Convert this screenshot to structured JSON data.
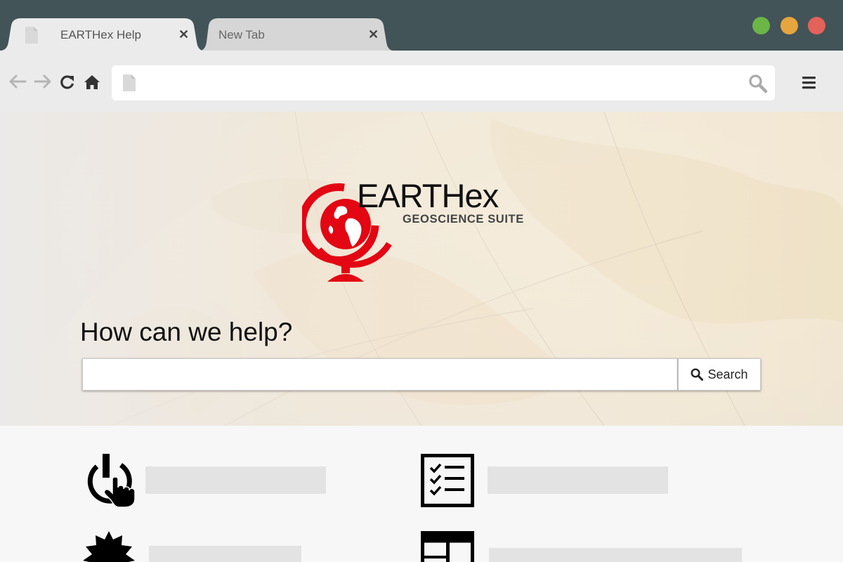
{
  "browser": {
    "tabs": [
      {
        "title": "EARTHex Help",
        "active": true
      },
      {
        "title": "New Tab",
        "active": false
      }
    ],
    "window_controls": [
      "maximize-green",
      "minimize-yellow",
      "close-red"
    ],
    "address_bar": {
      "value": "",
      "placeholder": ""
    },
    "nav_icons": [
      "back-arrow-icon",
      "forward-arrow-icon",
      "reload-icon",
      "home-icon"
    ]
  },
  "hero": {
    "logo": {
      "wordmark": "EARTHex",
      "tagline": "GEOSCIENCE SUITE"
    },
    "heading": "How can we help?",
    "search": {
      "value": "",
      "placeholder": "",
      "button_label": "Search"
    }
  },
  "categories": [
    {
      "icon": "power-touch-icon"
    },
    {
      "icon": "checklist-icon"
    },
    {
      "icon": "badge-star-icon"
    },
    {
      "icon": "layout-grid-icon"
    }
  ],
  "colors": {
    "brand_red": "#e30613",
    "titlebar": "#425458",
    "toolbar": "#ebebeb",
    "content_bg": "#f7f7f7",
    "dot_green": "#6bb646",
    "dot_yellow": "#e7a53d",
    "dot_red": "#e3625a"
  }
}
